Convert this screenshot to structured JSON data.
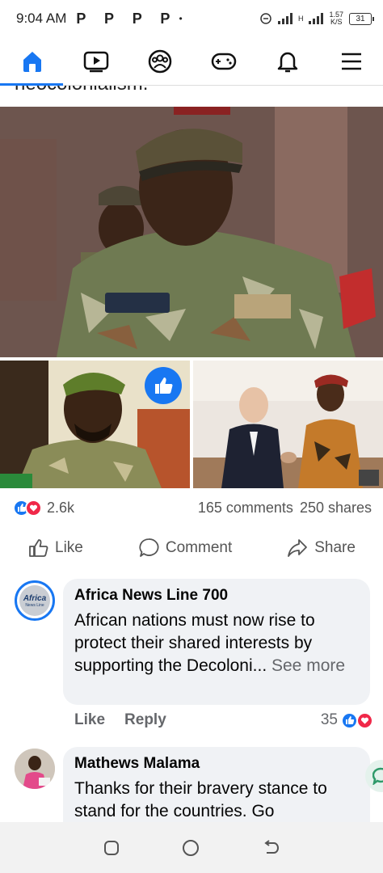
{
  "status_bar": {
    "time": "9:04 AM",
    "notifications": "P P P P",
    "dot": "•",
    "net_speed_value": "1.57",
    "net_speed_unit": "K/S",
    "signal_label": "H",
    "battery": "31"
  },
  "nav": {
    "items": [
      "home",
      "watch",
      "groups",
      "gaming",
      "notifications",
      "menu"
    ]
  },
  "post": {
    "clipped_text": "neocolonialism.",
    "reaction_count": "2.6k",
    "comments_count": "165 comments",
    "shares_count": "250 shares",
    "actions": {
      "like": "Like",
      "comment": "Comment",
      "share": "Share"
    }
  },
  "comments": [
    {
      "author": "Africa News Line 700",
      "avatar_text": "Africa",
      "avatar_subtext": "News Line",
      "text": "African nations must now rise to protect their shared interests by supporting the Decoloni...",
      "see_more": "See more",
      "like_label": "Like",
      "reply_label": "Reply",
      "reaction_count": "35"
    },
    {
      "author": "Mathews Malama",
      "text": "Thanks for their bravery stance to stand for the countries. Go"
    }
  ],
  "colors": {
    "accent": "#1877f2",
    "love": "#f02849",
    "bubble": "#f0f2f5",
    "muted": "#65676b"
  }
}
